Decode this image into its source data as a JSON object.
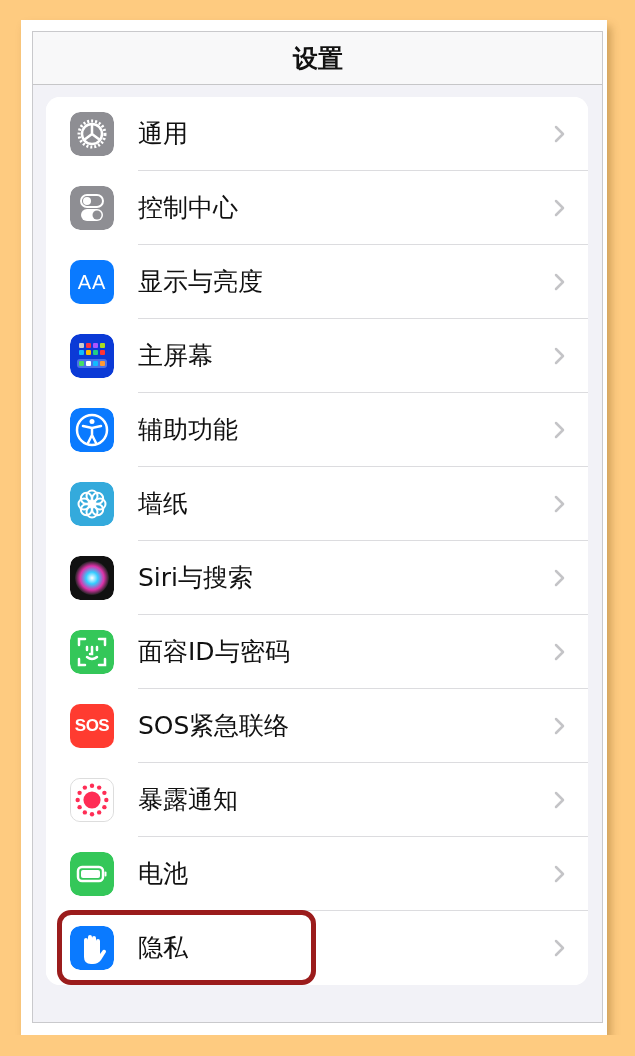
{
  "navigation_bar": {
    "title": "设置"
  },
  "settings": [
    {
      "kind": "general",
      "label": "通用",
      "highlighted": false
    },
    {
      "kind": "control",
      "label": "控制中心",
      "highlighted": false
    },
    {
      "kind": "display",
      "label": "显示与亮度",
      "glyph": "AA",
      "highlighted": false
    },
    {
      "kind": "home",
      "label": "主屏幕",
      "highlighted": false
    },
    {
      "kind": "accessibility",
      "label": "辅助功能",
      "highlighted": false
    },
    {
      "kind": "wallpaper",
      "label": "墙纸",
      "highlighted": false
    },
    {
      "kind": "siri",
      "label": "Siri与搜索",
      "highlighted": false
    },
    {
      "kind": "faceid",
      "label": "面容ID与密码",
      "highlighted": false
    },
    {
      "kind": "sos",
      "label": "SOS紧急联络",
      "glyph": "SOS",
      "highlighted": false
    },
    {
      "kind": "exposure",
      "label": "暴露通知",
      "highlighted": false
    },
    {
      "kind": "battery",
      "label": "电池",
      "highlighted": false
    },
    {
      "kind": "privacy",
      "label": "隐私",
      "highlighted": true
    }
  ]
}
